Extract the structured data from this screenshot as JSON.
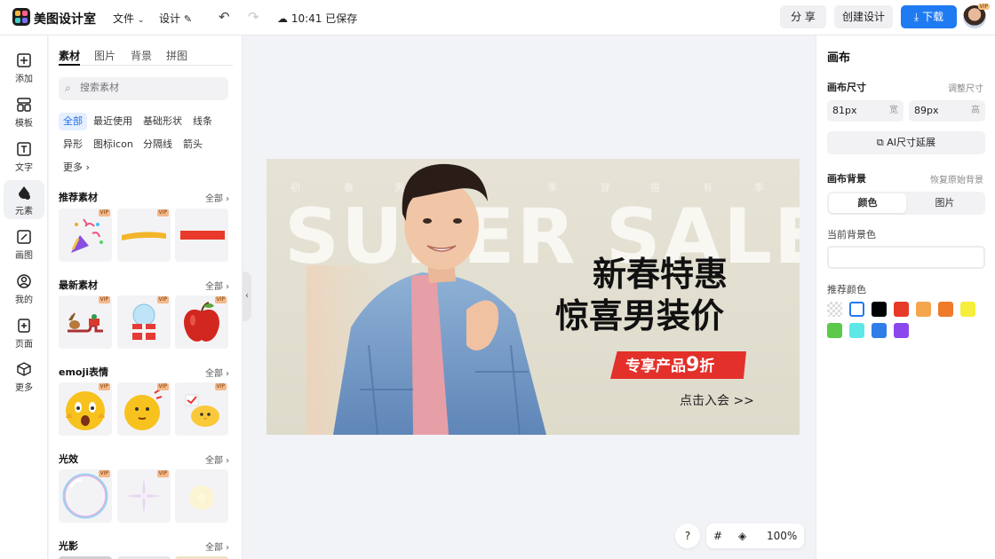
{
  "app": {
    "name": "美图设计室"
  },
  "topbar": {
    "file_menu": "文件",
    "design_menu": "设计",
    "save_status": "10:41 已保存",
    "share_label": "分 享",
    "create_label": "创建设计",
    "download_label": "下载",
    "avatar_badge": "VIP"
  },
  "rail": {
    "items": [
      {
        "label": "添加",
        "icon": "plus-square-icon"
      },
      {
        "label": "模板",
        "icon": "template-icon"
      },
      {
        "label": "文字",
        "icon": "text-icon"
      },
      {
        "label": "元素",
        "icon": "shapes-icon"
      },
      {
        "label": "画图",
        "icon": "draw-icon"
      },
      {
        "label": "我的",
        "icon": "user-icon"
      },
      {
        "label": "页面",
        "icon": "add-page-icon"
      },
      {
        "label": "更多",
        "icon": "cube-icon"
      }
    ],
    "active_index": 3
  },
  "assets": {
    "tabs": [
      "素材",
      "图片",
      "背景",
      "拼图"
    ],
    "search_placeholder": "搜索素材",
    "chips": [
      "全部",
      "最近使用",
      "基础形状",
      "线条",
      "异形",
      "图标icon",
      "分隔线",
      "箭头",
      "更多"
    ],
    "sections": [
      {
        "title": "推荐素材",
        "all": "全部"
      },
      {
        "title": "最新素材",
        "all": "全部"
      },
      {
        "title": "emoji表情",
        "all": "全部"
      },
      {
        "title": "光效",
        "all": "全部"
      },
      {
        "title": "光影",
        "all": "全部"
      }
    ],
    "vip_label": "VIP"
  },
  "canvas": {
    "spring_chars": [
      "初",
      "春",
      "男",
      "",
      "",
      "",
      "",
      "",
      "",
      "季",
      "穿",
      "搭",
      "有",
      "季"
    ],
    "super_text": "SUPER SALE",
    "headline_line1": "新春特惠",
    "headline_line2": "惊喜男装价",
    "ribbon_text": "专享产品",
    "ribbon_big": "9",
    "ribbon_tail": "折",
    "join_text": "点击入会 >>"
  },
  "bottom": {
    "help": "?",
    "zoom": "100%"
  },
  "right_panel": {
    "title": "画布",
    "size_label": "画布尺寸",
    "adjust_size": "调整尺寸",
    "width_value": "81px",
    "width_unit": "宽",
    "height_value": "89px",
    "height_unit": "高",
    "ai_button": "AI尺寸延展",
    "bg_label": "画布背景",
    "restore_bg": "恢复原始背景",
    "bg_options": [
      "颜色",
      "图片"
    ],
    "current_bg_label": "当前背景色",
    "recommended_label": "推荐颜色",
    "colors": [
      "transparent",
      "#ffffff",
      "#000000",
      "#e83a28",
      "#f3a64b",
      "#ef7a29",
      "#f5ee3c",
      "#5cc94a",
      "#5de8e7",
      "#2f7de9",
      "#8b47ee"
    ]
  }
}
